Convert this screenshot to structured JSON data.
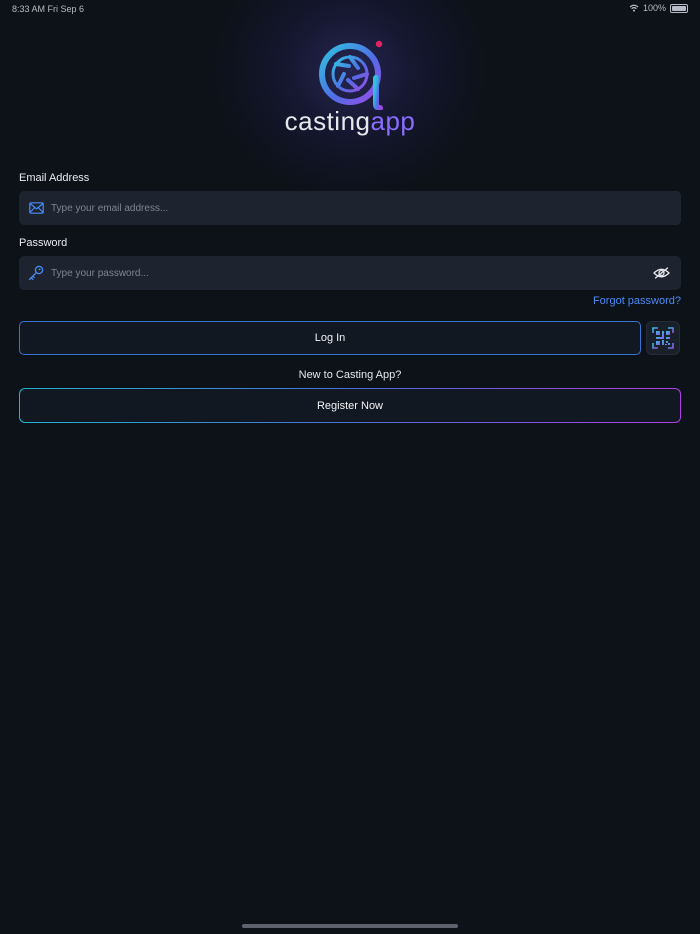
{
  "status_bar": {
    "time_date": "8:33 AM  Fri Sep 6",
    "battery": "100%"
  },
  "logo": {
    "word_primary": "casting",
    "word_accent": "app"
  },
  "form": {
    "email_label": "Email Address",
    "email_placeholder": "Type your email address...",
    "password_label": "Password",
    "password_placeholder": "Type your password...",
    "forgot_password": "Forgot password?",
    "login_label": "Log In",
    "new_to_text": "New to Casting App?",
    "register_label": "Register Now"
  },
  "icons": {
    "email": "envelope-icon",
    "password": "key-icon",
    "toggle_visibility": "eye-slash-icon",
    "qr": "qr-code-icon",
    "wifi": "wifi-icon"
  },
  "colors": {
    "background": "#0d1118",
    "input_bg": "#1d2430",
    "accent_blue": "#4a8cf7",
    "accent_purple": "#8a6cff",
    "gradient_start": "#23b3cf",
    "gradient_end": "#b13fe0",
    "logo_dot": "#e0245e"
  }
}
